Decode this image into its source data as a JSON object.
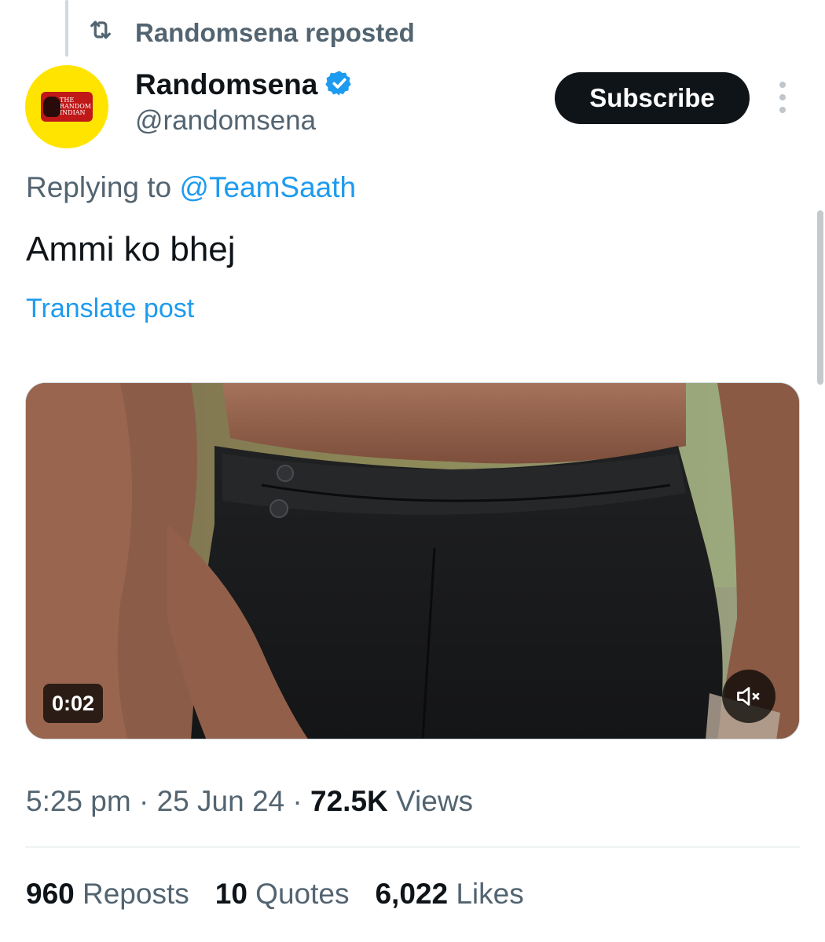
{
  "repost": {
    "icon": "repost-icon",
    "text": "Randomsena reposted"
  },
  "author": {
    "avatar_label": "THE RANDOM INDIAN",
    "display_name": "Randomsena",
    "verified_icon": "verified-badge-icon",
    "handle": "@randomsena"
  },
  "actions": {
    "subscribe_label": "Subscribe",
    "more_icon": "more-vertical-icon"
  },
  "post": {
    "replying_prefix": "Replying to ",
    "replying_to": "@TeamSaath",
    "text": "Ammi ko bhej",
    "translate_label": "Translate post"
  },
  "media": {
    "timer": "0:02",
    "mute_icon": "volume-muted-icon"
  },
  "meta": {
    "time": "5:25 pm",
    "separator": " · ",
    "date": "25 Jun 24",
    "views_count": "72.5K",
    "views_label": " Views"
  },
  "stats": {
    "reposts_count": "960",
    "reposts_label": " Reposts",
    "quotes_count": "10",
    "quotes_label": " Quotes",
    "likes_count": "6,022",
    "likes_label": " Likes"
  },
  "colors": {
    "link": "#1d9bf0",
    "secondary_text": "#536471",
    "primary_text": "#0f1419",
    "avatar_bg": "#ffe400"
  }
}
